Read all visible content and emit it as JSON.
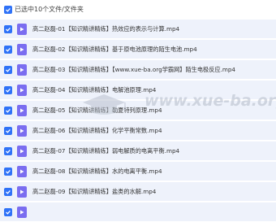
{
  "header": {
    "selection_text": "已选中10个文件/文件夹"
  },
  "files": [
    {
      "name": "高二赵磊-01【知识精讲精练】热效应的表示与计算.mp4"
    },
    {
      "name": "高二赵磊-02【知识精讲精练】基于原电池原理的陌生电池.mp4"
    },
    {
      "name": "高二赵磊-03【知识精讲精练】【www.xue-ba.org学霸网】陌生电极反应.mp4"
    },
    {
      "name": "高二赵磊-04【知识精讲精练】电解池原理.mp4"
    },
    {
      "name": "高二赵磊-05【知识精讲精练】勒夏特列原理.mp4"
    },
    {
      "name": "高二赵磊-06【知识精讲精练】化学平衡常数.mp4"
    },
    {
      "name": "高二赵磊-07【知识精讲精练】弱电解质的电离平衡.mp4"
    },
    {
      "name": "高二赵磊-08【知识精讲精练】水的电离平衡.mp4"
    },
    {
      "name": "高二赵磊-09【知识精讲精练】盐类的水解.mp4"
    },
    {
      "name": ""
    }
  ],
  "watermark": {
    "text": "www.xue-ba.org"
  },
  "colors": {
    "accent": "#2f72f7",
    "file_icon": "#7a6df0",
    "row_bg": "#eef2fb"
  }
}
